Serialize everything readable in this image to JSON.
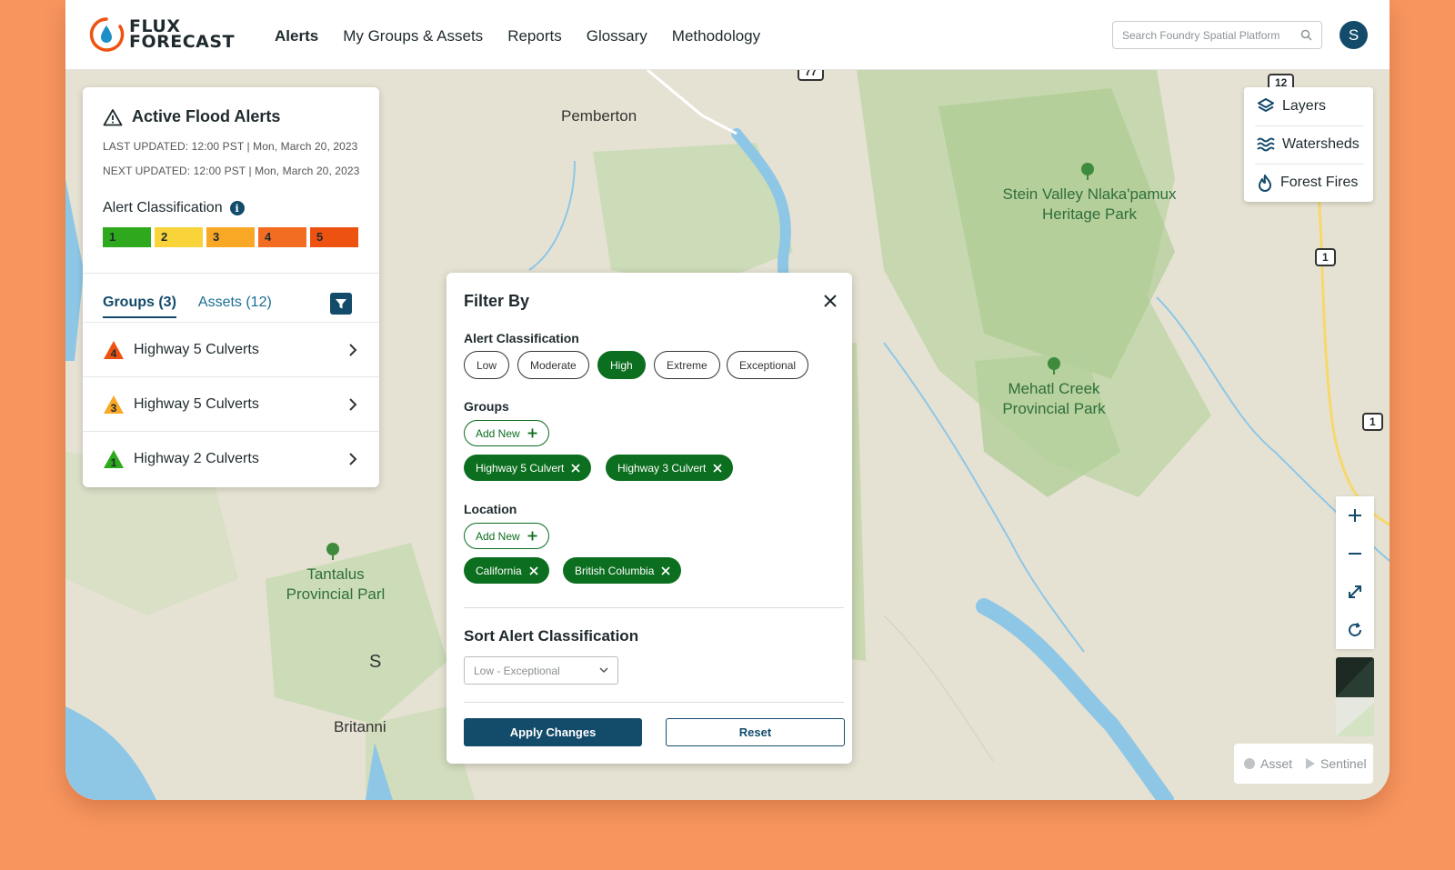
{
  "app": {
    "logo_line1": "FLUX",
    "logo_line2": "FORECAST",
    "nav": [
      "Alerts",
      "My Groups & Assets",
      "Reports",
      "Glossary",
      "Methodology"
    ],
    "search_placeholder": "Search Foundry Spatial Platform",
    "avatar_initial": "S"
  },
  "alerts_panel": {
    "title": "Active Flood Alerts",
    "last_updated": "LAST UPDATED: 12:00 PST | Mon, March 20, 2023",
    "next_updated": "NEXT UPDATED: 12:00 PST | Mon, March 20, 2023",
    "classification_label": "Alert Classification",
    "scale": [
      {
        "label": "1",
        "color": "#2EA81C"
      },
      {
        "label": "2",
        "color": "#F8D33A"
      },
      {
        "label": "3",
        "color": "#F9A825"
      },
      {
        "label": "4",
        "color": "#F26C22"
      },
      {
        "label": "5",
        "color": "#EE5211"
      }
    ],
    "tabs": [
      "Groups (3)",
      "Assets (12)"
    ],
    "groups": [
      {
        "level": "4",
        "color": "#EE5211",
        "name": "Highway 5 Culverts"
      },
      {
        "level": "3",
        "color": "#F9A825",
        "name": "Highway 5 Culverts"
      },
      {
        "level": "1",
        "color": "#2EA81C",
        "name": "Highway 2 Culverts"
      }
    ]
  },
  "filter": {
    "title": "Filter By",
    "classification_title": "Alert Classification",
    "classification_options": [
      "Low",
      "Moderate",
      "High",
      "Extreme",
      "Exceptional"
    ],
    "selected_classification": "High",
    "groups_title": "Groups",
    "add_new": "Add New",
    "group_tags": [
      "Highway 5 Culvert",
      "Highway 3 Culvert"
    ],
    "location_title": "Location",
    "location_tags": [
      "California",
      "British Columbia"
    ],
    "sort_title": "Sort Alert Classification",
    "sort_value": "Low - Exceptional",
    "apply": "Apply Changes",
    "reset": "Reset"
  },
  "layers": [
    "Layers",
    "Watersheds",
    "Forest Fires"
  ],
  "map": {
    "places": [
      "Pemberton",
      "S",
      "Britanni"
    ],
    "parks": [
      "Stein Valley Nlaka'pamux\nHeritage Park",
      "Mehatl Creek\nProvincial Park",
      "Tantalus\nProvincial Parl"
    ],
    "shields": [
      "12",
      "1",
      "1",
      "77"
    ]
  },
  "legend": {
    "asset": "Asset",
    "sentinel": "Sentinel"
  }
}
